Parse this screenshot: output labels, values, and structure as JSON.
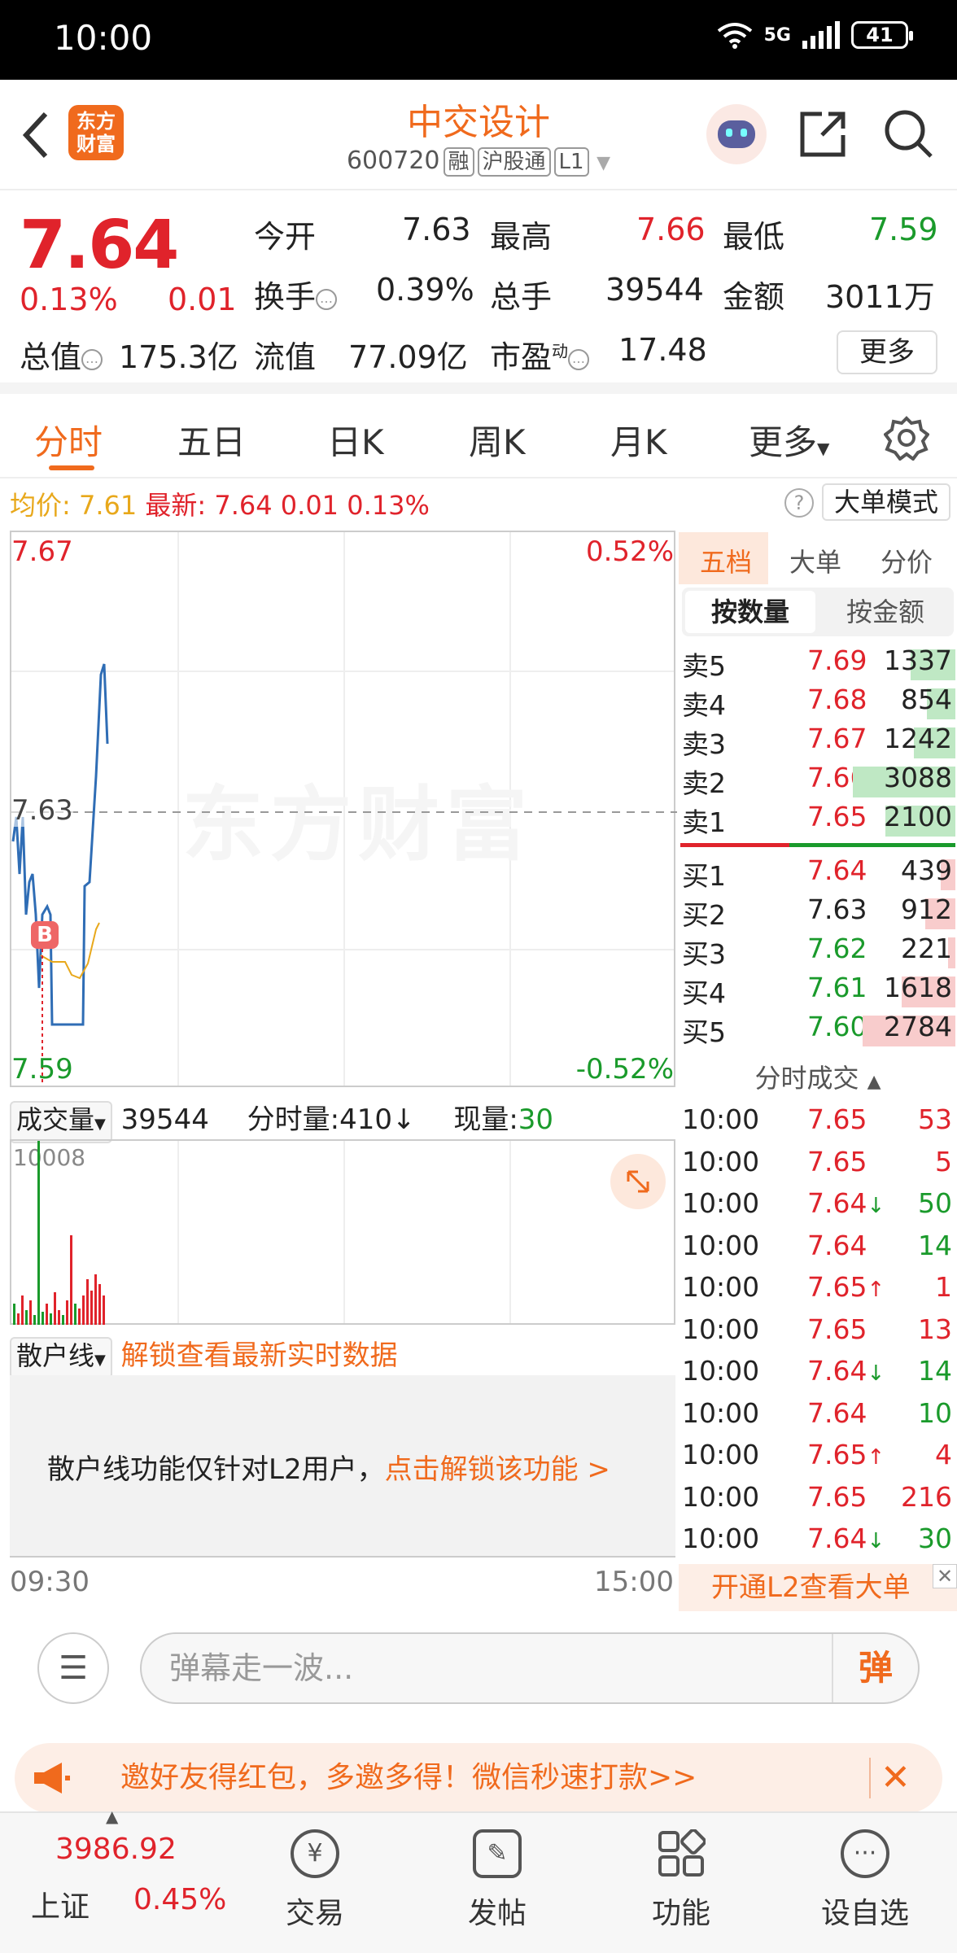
{
  "status_bar": {
    "time": "10:00",
    "network": "5G",
    "battery": "41"
  },
  "header": {
    "logo_line1": "东方",
    "logo_line2": "财富",
    "name": "中交设计",
    "code": "600720",
    "tags": [
      "融",
      "沪股通",
      "L1"
    ]
  },
  "quote": {
    "price": "7.64",
    "change_pct": "0.13%",
    "change": "0.01",
    "open_label": "今开",
    "open": "7.63",
    "high_label": "最高",
    "high": "7.66",
    "low_label": "最低",
    "low": "7.59",
    "turnover_label": "换手",
    "turnover": "0.39%",
    "volume_label": "总手",
    "volume": "39544",
    "amount_label": "金额",
    "amount": "3011万",
    "mktcap_label": "总值",
    "mktcap": "175.3亿",
    "float_label": "流值",
    "float": "77.09亿",
    "pe_label": "市盈",
    "pe_sup": "动",
    "pe": "17.48",
    "more": "更多"
  },
  "tabs": [
    "分时",
    "五日",
    "日K",
    "周K",
    "月K",
    "更多"
  ],
  "info_line": {
    "avg_label": "均价:",
    "avg": "7.61",
    "latest_label": "最新:",
    "latest": "7.64",
    "chg": "0.01",
    "pct": "0.13%",
    "mode": "大单模式"
  },
  "chart": {
    "top_price": "7.67",
    "top_pct": "0.52%",
    "mid_price": "7.63",
    "bottom_price": "7.59",
    "bottom_pct": "-0.52%",
    "watermark": "东方财富",
    "marker": "B"
  },
  "volume": {
    "dropdown": "成交量",
    "total": "39544",
    "minute_label": "分时量:",
    "minute": "410↓",
    "now_label": "现量:",
    "now": "30",
    "max_label": "10008"
  },
  "retail": {
    "dropdown": "散户线",
    "unlock": "解锁查看最新实时数据",
    "notice": "散户线功能仅针对L2用户，",
    "notice_link": "点击解锁该功能 >"
  },
  "time_axis": {
    "start": "09:30",
    "end": "15:00"
  },
  "book": {
    "tabs": [
      "五档",
      "大单",
      "分价"
    ],
    "toggle": [
      "按数量",
      "按金额"
    ],
    "asks": [
      {
        "label": "卖5",
        "price": "7.69",
        "qty": "1337"
      },
      {
        "label": "卖4",
        "price": "7.68",
        "qty": "854"
      },
      {
        "label": "卖3",
        "price": "7.67",
        "qty": "1242"
      },
      {
        "label": "卖2",
        "price": "7.66",
        "qty": "3088"
      },
      {
        "label": "卖1",
        "price": "7.65",
        "qty": "2100"
      }
    ],
    "bids": [
      {
        "label": "买1",
        "price": "7.64",
        "qty": "439"
      },
      {
        "label": "买2",
        "price": "7.63",
        "qty": "912"
      },
      {
        "label": "买3",
        "price": "7.62",
        "qty": "221"
      },
      {
        "label": "买4",
        "price": "7.61",
        "qty": "1618"
      },
      {
        "label": "买5",
        "price": "7.60",
        "qty": "2784"
      }
    ],
    "ticks_title": "分时成交",
    "ticks": [
      {
        "time": "10:00",
        "price": "7.65",
        "arrow": "",
        "vol": "53"
      },
      {
        "time": "10:00",
        "price": "7.65",
        "arrow": "",
        "vol": "5"
      },
      {
        "time": "10:00",
        "price": "7.64",
        "arrow": "↓",
        "vol": "50"
      },
      {
        "time": "10:00",
        "price": "7.64",
        "arrow": "",
        "vol": "14"
      },
      {
        "time": "10:00",
        "price": "7.65",
        "arrow": "↑",
        "vol": "1"
      },
      {
        "time": "10:00",
        "price": "7.65",
        "arrow": "",
        "vol": "13"
      },
      {
        "time": "10:00",
        "price": "7.64",
        "arrow": "↓",
        "vol": "14"
      },
      {
        "time": "10:00",
        "price": "7.64",
        "arrow": "",
        "vol": "10"
      },
      {
        "time": "10:00",
        "price": "7.65",
        "arrow": "↑",
        "vol": "4"
      },
      {
        "time": "10:00",
        "price": "7.65",
        "arrow": "",
        "vol": "216"
      },
      {
        "time": "10:00",
        "price": "7.64",
        "arrow": "↓",
        "vol": "30"
      }
    ],
    "l2_banner": "开通L2查看大单"
  },
  "comment": {
    "placeholder": "弹幕走一波...",
    "danmu": "弹"
  },
  "promo": {
    "text": "邀好友得红包，多邀多得！微信秒速打款>>"
  },
  "bottom_nav": {
    "index_value": "3986.92",
    "index_name": "上证",
    "index_pct": "0.45%",
    "items": [
      "交易",
      "发帖",
      "功能",
      "设自选"
    ]
  },
  "colors": {
    "accent": "#f06a1d",
    "up": "#e0232b",
    "down": "#1a9a2b",
    "avg_line": "#e8a81b",
    "price_line": "#2f6db5"
  },
  "icons": [
    "back-icon",
    "robot-icon",
    "share-icon",
    "search-icon",
    "settings-icon",
    "help-icon",
    "expand-icon",
    "megaphone-icon",
    "close-icon"
  ]
}
